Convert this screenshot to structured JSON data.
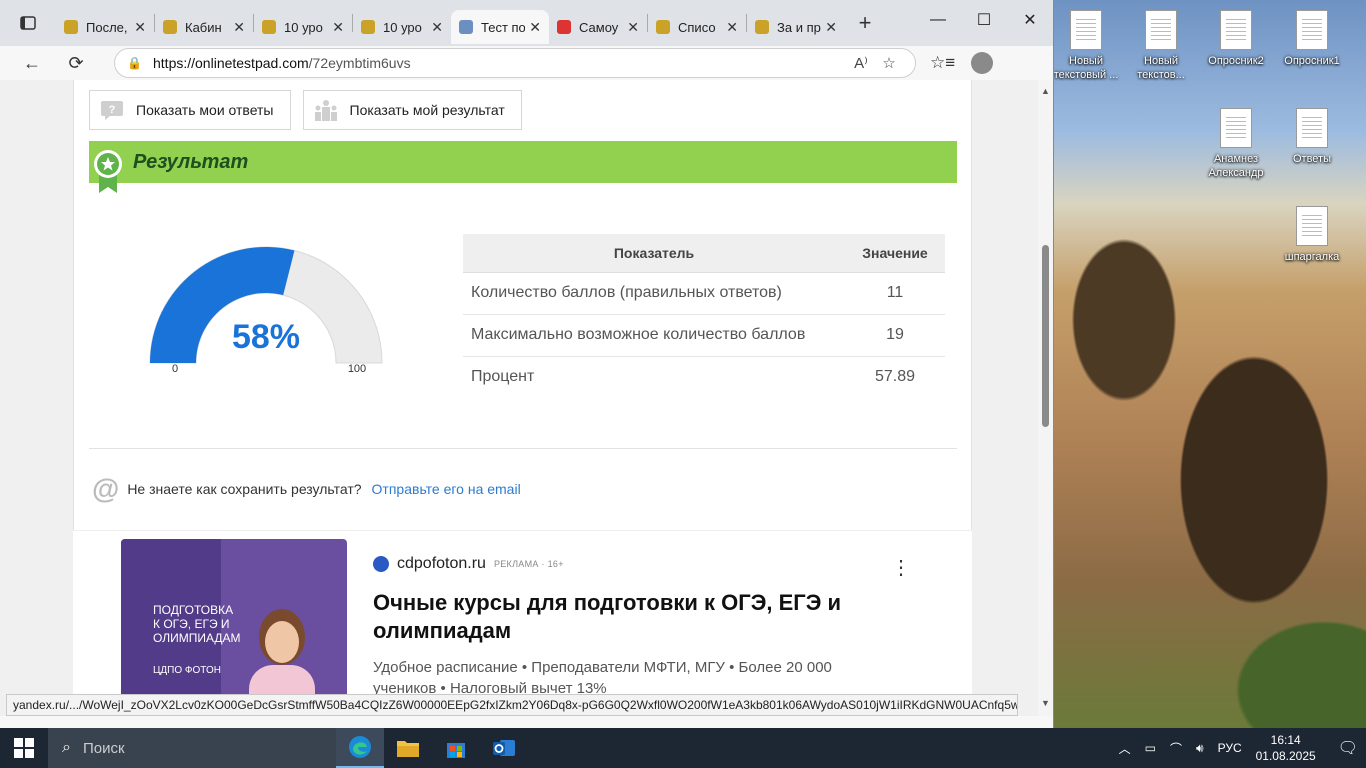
{
  "browser": {
    "tabs": [
      {
        "title": "После,",
        "color": "#c9a227"
      },
      {
        "title": "Кабин",
        "color": "#c9a227"
      },
      {
        "title": "10 уро",
        "color": "#c9a227"
      },
      {
        "title": "10 уро",
        "color": "#c9a227"
      },
      {
        "title": "Тест по",
        "color": "#6c8fc2",
        "active": true
      },
      {
        "title": "Самоу",
        "color": "#d33"
      },
      {
        "title": "Списо",
        "color": "#c9a227"
      },
      {
        "title": "За и пр",
        "color": "#c9a227"
      }
    ],
    "url_host": "https://onlinetestpad.com",
    "url_path": "/72eymbtim6uvs",
    "status_url": "yandex.ru/.../WoWejI_zOoVX2Lcv0zKO00GeDcGsrStmffW50Ba4CQIzZ6W00000EEpG2fxIZkm2Y06Dq8x-pG6G0Q2Wxfl0WO200fW1eA3kb801k06AWydoAS010jW1iIRKdGNW0UACnfq5w06s0..."
  },
  "page": {
    "buttons": {
      "show_answers": "Показать мои ответы",
      "show_result": "Показать мой результат"
    },
    "result_title": "Результат",
    "gauge": {
      "percent_label": "58%",
      "value_fraction": 0.5789,
      "min_label": "0",
      "max_label": "100",
      "fill_color": "#1a73d9",
      "track_color": "#ebebeb"
    },
    "table": {
      "headers": {
        "indicator": "Показатель",
        "value": "Значение"
      },
      "rows": [
        {
          "label": "Количество баллов (правильных ответов)",
          "value": "11"
        },
        {
          "label": "Максимально возможное количество баллов",
          "value": "19"
        },
        {
          "label": "Процент",
          "value": "57.89"
        }
      ]
    },
    "save": {
      "question": "Не знаете как сохранить результат?",
      "link": "Отправьте его на email"
    },
    "ad": {
      "domain": "cdpofoton.ru",
      "tag": "РЕКЛАМА · 16+",
      "title": "Очные курсы для подготовки к ОГЭ, ЕГЭ и олимпиадам",
      "text": "Удобное расписание • Преподаватели МФТИ, МГУ • Более 20 000 учеников • Налоговый вычет 13%",
      "image_text_1": "ПОДГОТОВКА",
      "image_text_2": "К ОГЭ, ЕГЭ И",
      "image_text_3": "ОЛИМПИАДАМ",
      "image_brand": "ЦДПО ФОТОН"
    }
  },
  "desktop": {
    "icons": [
      {
        "label": "Новый текстовый ..."
      },
      {
        "label": "Новый текстов..."
      },
      {
        "label": "Опросник2"
      },
      {
        "label": "Опросник1"
      },
      {
        "label": "Анамнез Александр"
      },
      {
        "label": "Ответы"
      },
      {
        "label": "шпаргалка"
      }
    ]
  },
  "taskbar": {
    "search_placeholder": "Поиск",
    "lang": "РУС",
    "time": "16:14",
    "date": "01.08.2025"
  }
}
